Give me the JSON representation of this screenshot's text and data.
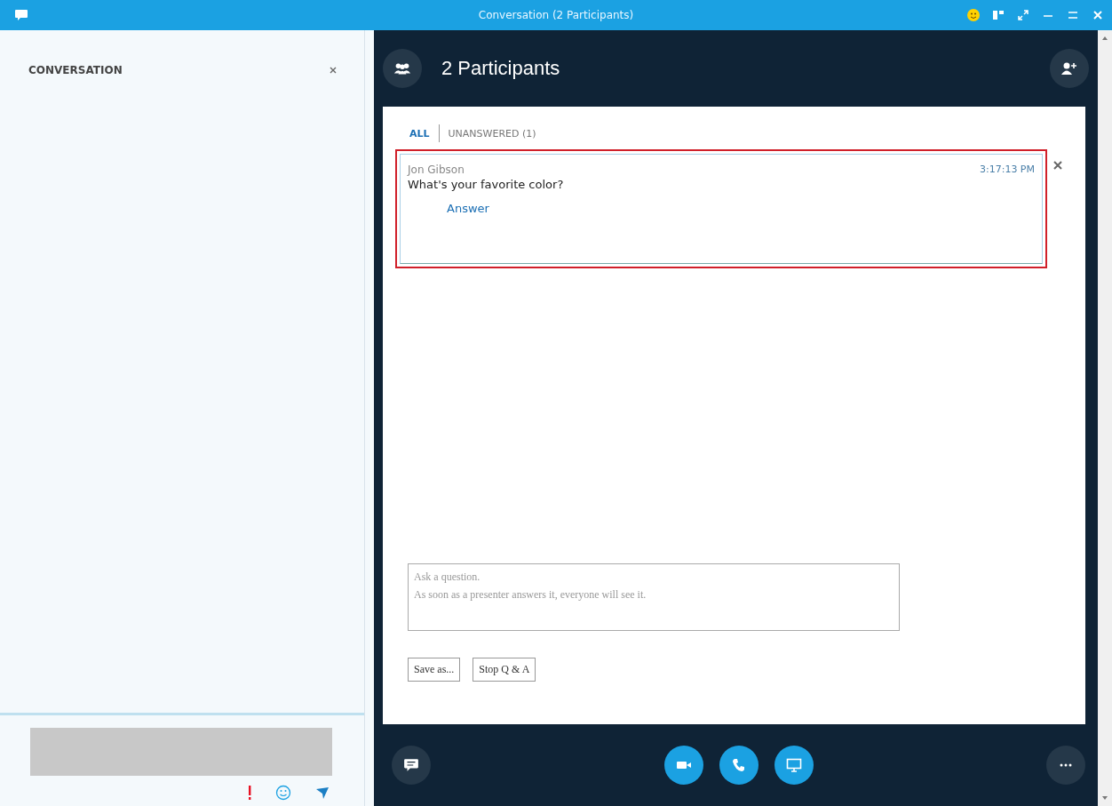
{
  "window": {
    "title": "Conversation (2 Participants)"
  },
  "left_panel": {
    "title": "CONVERSATION"
  },
  "header": {
    "title": "2 Participants"
  },
  "tabs": [
    {
      "label": "ALL",
      "selected": true
    },
    {
      "label": "UNANSWERED (1)",
      "selected": false
    }
  ],
  "questions": [
    {
      "author": "Jon Gibson",
      "time": "3:17:13 PM",
      "text": "What's your favorite color?",
      "action": "Answer",
      "highlighted": true
    }
  ],
  "question_field": {
    "placeholder": "Ask a question.\nAs soon as a presenter answers it, everyone will see it."
  },
  "buttons": [
    "Save as...",
    "Stop Q & A"
  ]
}
